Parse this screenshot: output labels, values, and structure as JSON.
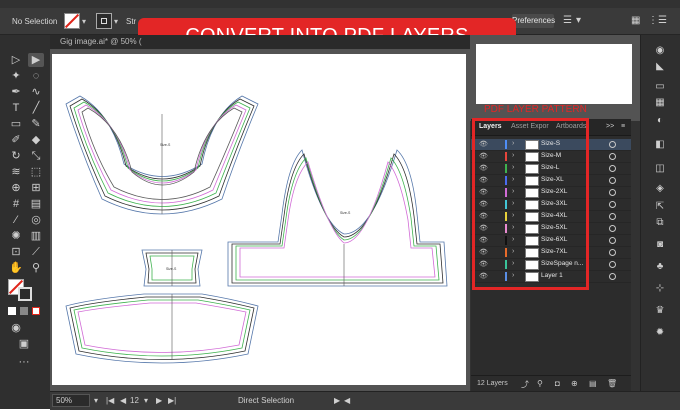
{
  "control_bar": {
    "selection_status": "No Selection",
    "stroke_label": "Str",
    "preferences_button": "Preferences"
  },
  "banner": {
    "text": "CONVERT INTO PDF LAYERS PATTERN",
    "color": "#e32626"
  },
  "document": {
    "tab_title": "Gig image.ai* @ 50% (",
    "artboard_labels": [
      "Size-S",
      "Size-S",
      "Size-S"
    ]
  },
  "annotation": {
    "label": "PDF LAYER PATTERN"
  },
  "layers_panel": {
    "tabs": [
      {
        "label": "Layers",
        "active": true
      },
      {
        "label": "Asset Expor",
        "active": false
      },
      {
        "label": "Artboards",
        "active": false
      }
    ],
    "menu_icon": ">>",
    "layers": [
      {
        "name": "Size-S",
        "color": "#4f8ef7"
      },
      {
        "name": "Size-M",
        "color": "#e8453c"
      },
      {
        "name": "Size-L",
        "color": "#3fb24f"
      },
      {
        "name": "Size-XL",
        "color": "#4a6cf0"
      },
      {
        "name": "Size-2XL",
        "color": "#d16bd6"
      },
      {
        "name": "Size-3XL",
        "color": "#43c6d6"
      },
      {
        "name": "Size-4XL",
        "color": "#e8d23a"
      },
      {
        "name": "Size-5XL",
        "color": "#e88ad0"
      },
      {
        "name": "Size-6XL",
        "color": "#2b2b2b"
      },
      {
        "name": "Size-7XL",
        "color": "#e86b2a"
      },
      {
        "name": "SizeSpage n...",
        "color": "#3ac49a"
      },
      {
        "name": "Layer 1",
        "color": "#5a8fe6"
      }
    ],
    "footer_count": "12 Layers"
  },
  "status_bar": {
    "zoom": "50%",
    "page": "12",
    "tool": "Direct Selection"
  }
}
